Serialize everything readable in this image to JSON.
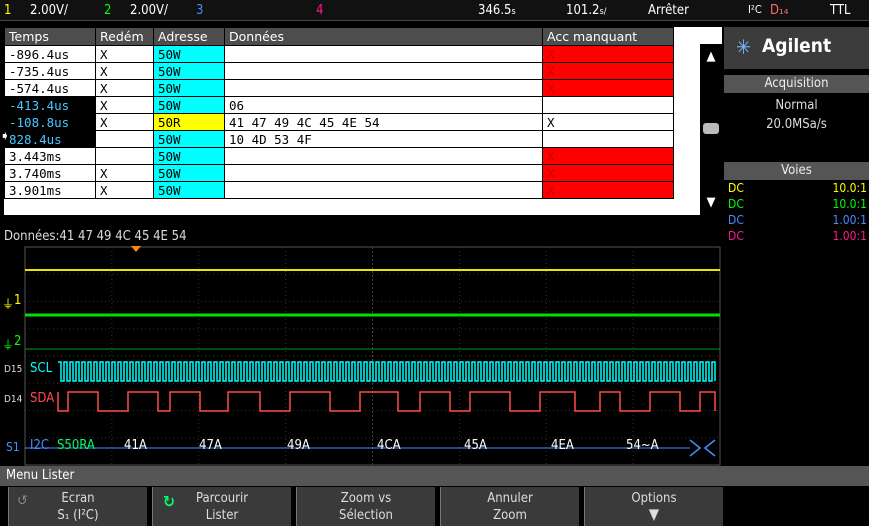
{
  "status_bar": {
    "ch1_num": "1",
    "ch1_scale": "2.00V/",
    "ch2_num": "2",
    "ch2_scale": "2.00V/",
    "ch3_num": "3",
    "ch4_num": "4",
    "time_pos": "346.5",
    "time_scale": "101.2",
    "run_state": "Arrêter",
    "trig_proto": "I²C",
    "trig_src": "D₁₄",
    "trig_level": "TTL"
  },
  "lister": {
    "headers": [
      "Temps",
      "Redém",
      "Adresse",
      "Données",
      "Acc manquant"
    ],
    "rows": [
      {
        "time": "-896.4us",
        "restart": "X",
        "addr": "50W",
        "data": "",
        "ack": "X"
      },
      {
        "time": "-735.4us",
        "restart": "X",
        "addr": "50W",
        "data": "",
        "ack": "X"
      },
      {
        "time": "-574.4us",
        "restart": "X",
        "addr": "50W",
        "data": "",
        "ack": "X"
      },
      {
        "time": "-413.4us",
        "restart": "X",
        "addr": "50W",
        "data": "06",
        "ack": ""
      },
      {
        "time": "-108.8us",
        "restart": "X",
        "addr": "50R",
        "data": "41  47  49  4C  45  4E  54",
        "ack": "X"
      },
      {
        "time": "828.4us",
        "restart": "",
        "addr": "50W",
        "data": "10  4D  53  4F",
        "ack": ""
      },
      {
        "time": "3.443ms",
        "restart": "",
        "addr": "50W",
        "data": "",
        "ack": "X"
      },
      {
        "time": "3.740ms",
        "restart": "X",
        "addr": "50W",
        "data": "",
        "ack": "X"
      },
      {
        "time": "3.901ms",
        "restart": "X",
        "addr": "50W",
        "data": "",
        "ack": "X"
      }
    ],
    "data_line": "Données:41  47  49  4C  45  4E  54"
  },
  "right_panel": {
    "brand": "Agilent",
    "acq_head": "Acquisition",
    "acq_mode": "Normal",
    "acq_rate": "20.0MSa/s",
    "voies_head": "Voies",
    "channels": [
      {
        "coupling": "DC",
        "ratio": "10.0:1",
        "color": "#ffff00"
      },
      {
        "coupling": "DC",
        "ratio": "10.0:1",
        "color": "#00ff00"
      },
      {
        "coupling": "DC",
        "ratio": "1.00:1",
        "color": "#4a8cff"
      },
      {
        "coupling": "DC",
        "ratio": "1.00:1",
        "color": "#ff1a8c"
      }
    ]
  },
  "waveform": {
    "ch1_label": "1",
    "ch2_label": "2",
    "scl_label": "SCL",
    "sda_label": "SDA",
    "d15_label": "D15",
    "d14_label": "D14",
    "bus_prefix": "S1",
    "bus_name": "I2C",
    "bus_packets": [
      "S50RA",
      "41A",
      "47A",
      "49A",
      "4CA",
      "45A",
      "4EA",
      "54~A"
    ]
  },
  "menu": {
    "title": "Menu Lister",
    "softkeys": [
      {
        "line1": "Ecran",
        "line2": "S₁ (I²C)"
      },
      {
        "line1": "Parcourir",
        "line2": "Lister"
      },
      {
        "line1": "Zoom vs",
        "line2": "Sélection"
      },
      {
        "line1": "Annuler",
        "line2": "Zoom"
      },
      {
        "line1": "Options",
        "line2": ""
      }
    ]
  }
}
